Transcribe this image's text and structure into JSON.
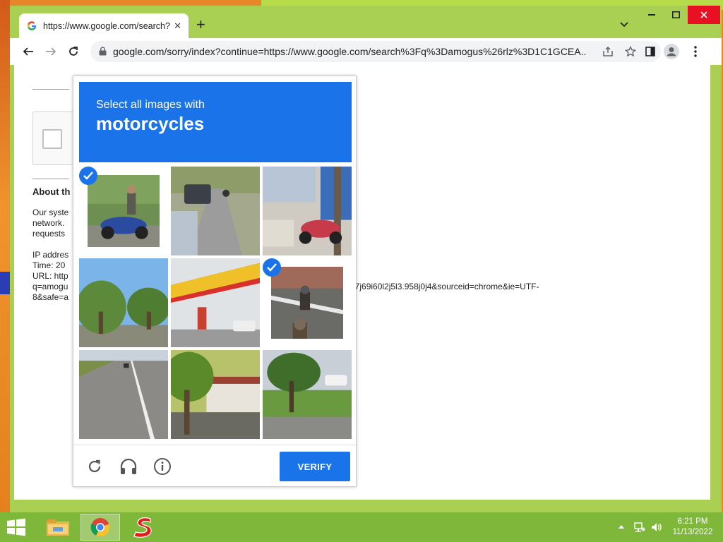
{
  "browser": {
    "tab_title": "https://www.google.com/search?",
    "url": "google.com/sorry/index?continue=https://www.google.com/search%3Fq%3Damogus%26rlz%3D1C1GCEA..."
  },
  "page": {
    "about_heading": "About th",
    "para1": [
      "Our syste",
      "network.",
      "requests"
    ],
    "ip_line": "IP addres",
    "time_line": "Time: 20",
    "url_line": "URL: http",
    "url_line2": "q=amogu",
    "url_line2_tail": "57j69i60l2j5l3.958j0j4&sourceid=chrome&ie=UTF-",
    "url_line3": "8&safe=a"
  },
  "captcha": {
    "instruction": "Select all images with",
    "target": "motorcycles",
    "verify_label": "VERIFY",
    "tiles": [
      {
        "selected": true,
        "desc": "motorcycle-rider"
      },
      {
        "selected": false,
        "desc": "road-car"
      },
      {
        "selected": false,
        "desc": "scooter-shop"
      },
      {
        "selected": false,
        "desc": "trees-road"
      },
      {
        "selected": true,
        "desc": "motorcyclist-road"
      },
      {
        "selected": false,
        "desc": "gas-station"
      },
      {
        "selected": false,
        "desc": "highway"
      },
      {
        "selected": false,
        "desc": "building-trees"
      },
      {
        "selected": false,
        "desc": "roadside-trees"
      }
    ]
  },
  "taskbar": {
    "time": "6:21 PM",
    "date": "11/13/2022"
  }
}
